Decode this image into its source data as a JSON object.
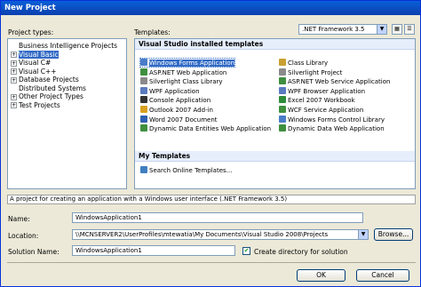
{
  "window": {
    "title": "New Project"
  },
  "project_types": {
    "label": "Project types:",
    "items": [
      {
        "label": "Business Intelligence Projects",
        "expander": "",
        "indent": 1,
        "selected": false
      },
      {
        "label": "Visual Basic",
        "expander": "+",
        "indent": 0,
        "selected": true
      },
      {
        "label": "Visual C#",
        "expander": "+",
        "indent": 0,
        "selected": false
      },
      {
        "label": "Visual C++",
        "expander": "+",
        "indent": 0,
        "selected": false
      },
      {
        "label": "Database Projects",
        "expander": "+",
        "indent": 0,
        "selected": false
      },
      {
        "label": "Distributed Systems",
        "expander": "",
        "indent": 1,
        "selected": false
      },
      {
        "label": "Other Project Types",
        "expander": "+",
        "indent": 0,
        "selected": false
      },
      {
        "label": "Test Projects",
        "expander": "+",
        "indent": 0,
        "selected": false
      }
    ]
  },
  "templates": {
    "label": "Templates:",
    "framework": ".NET Framework 3.5",
    "installed_header": "Visual Studio installed templates",
    "left_column": [
      {
        "label": "Windows Forms Application",
        "icon": "windows-forms-icon",
        "color": "#4a7cc9",
        "selected": true
      },
      {
        "label": "ASP.NET Web Application",
        "icon": "web-application-icon",
        "color": "#3f8f3f",
        "selected": false
      },
      {
        "label": "Silverlight Class Library",
        "icon": "silverlight-icon",
        "color": "#8a8a8a",
        "selected": false
      },
      {
        "label": "WPF Application",
        "icon": "wpf-icon",
        "color": "#5b7bc0",
        "selected": false
      },
      {
        "label": "Console Application",
        "icon": "console-icon",
        "color": "#333333",
        "selected": false
      },
      {
        "label": "Outlook 2007 Add-in",
        "icon": "outlook-icon",
        "color": "#d9a021",
        "selected": false
      },
      {
        "label": "Word 2007 Document",
        "icon": "word-icon",
        "color": "#2f5fb3",
        "selected": false
      },
      {
        "label": "Dynamic Data Entities Web Application",
        "icon": "dynamic-data-icon",
        "color": "#3f8f3f",
        "selected": false
      }
    ],
    "right_column": [
      {
        "label": "Class Library",
        "icon": "class-library-icon",
        "color": "#c8a032",
        "selected": false
      },
      {
        "label": "Silverlight Project",
        "icon": "silverlight-icon",
        "color": "#8a8a8a",
        "selected": false
      },
      {
        "label": "ASP.NET Web Service Application",
        "icon": "web-service-icon",
        "color": "#3f8f3f",
        "selected": false
      },
      {
        "label": "WPF Browser Application",
        "icon": "wpf-browser-icon",
        "color": "#5b7bc0",
        "selected": false
      },
      {
        "label": "Excel 2007 Workbook",
        "icon": "excel-icon",
        "color": "#2e8b3a",
        "selected": false
      },
      {
        "label": "WCF Service Application",
        "icon": "wcf-icon",
        "color": "#3f8f3f",
        "selected": false
      },
      {
        "label": "Windows Forms Control Library",
        "icon": "control-library-icon",
        "color": "#4a7cc9",
        "selected": false
      },
      {
        "label": "Dynamic Data Web Application",
        "icon": "dynamic-data-icon",
        "color": "#3f8f3f",
        "selected": false
      }
    ],
    "my_header": "My Templates",
    "my_items": [
      {
        "label": "Search Online Templates...",
        "icon": "search-online-icon",
        "color": "#3f7fbf"
      }
    ]
  },
  "description": "A project for creating an application with a Windows user interface (.NET Framework 3.5)",
  "form": {
    "name_label": "Name:",
    "name_value": "WindowsApplication1",
    "location_label": "Location:",
    "location_value": "\\\\MCNSERVER2\\UserProfiles\\mtewatia\\My Documents\\Visual Studio 2008\\Projects",
    "browse_label": "Browse...",
    "solution_label": "Solution Name:",
    "solution_value": "WindowsApplication1",
    "create_dir_label": "Create directory for solution",
    "create_dir_checked": true
  },
  "buttons": {
    "ok": "OK",
    "cancel": "Cancel"
  },
  "icons": {
    "tiles_view": "large-icons-view-icon",
    "list_view": "small-icons-view-icon"
  }
}
